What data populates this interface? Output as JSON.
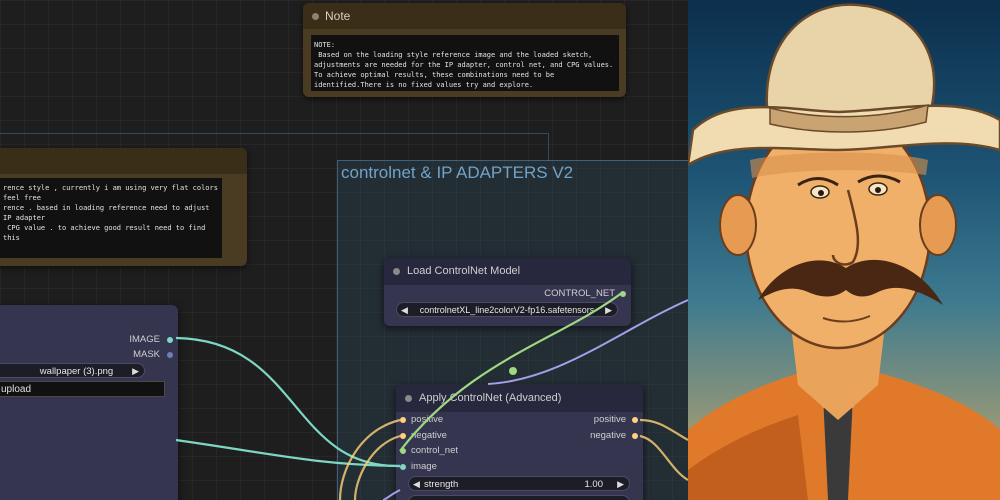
{
  "canvas": {
    "group": {
      "title": "controlnet & IP ADAPTERS V2"
    },
    "note_top": {
      "title": "Note",
      "body": "NOTE:\n Based on the loading style reference image and the loaded sketch, adjustments are needed for the IP adapter, control net, and CPG values. To achieve optimal results, these combinations need to be identified.There is no fixed values try and explore."
    },
    "note_left": {
      "title": "",
      "body": "rence style , currently i am using very flat colors feel free\nrence . based in loading reference need to adjust IP adapter\n CPG value . to achieve good result need to find this"
    },
    "load_image": {
      "outputs": [
        "IMAGE",
        "MASK"
      ],
      "image_value": "wallpaper (3).png",
      "upload_label": "upload"
    },
    "load_controlnet": {
      "title": "Load ControlNet Model",
      "output": "CONTROL_NET",
      "model_value": "controlnetXL_line2colorV2-fp16.safetensors"
    },
    "apply_controlnet": {
      "title": "Apply ControlNet (Advanced)",
      "inputs": [
        "positive",
        "negative",
        "control_net",
        "image"
      ],
      "outputs": [
        "positive",
        "negative"
      ],
      "strength_label": "strength",
      "strength_value": "1.00"
    }
  },
  "colors": {
    "conditioning": "#ffd27a",
    "image_wire": "#7fd6c2",
    "controlnet_wire": "#9fd783",
    "mask_pin": "#7cb8ff",
    "other_wire": "#a59ee8"
  },
  "artwork": {
    "subject": "cartoon cowboy illustration"
  }
}
